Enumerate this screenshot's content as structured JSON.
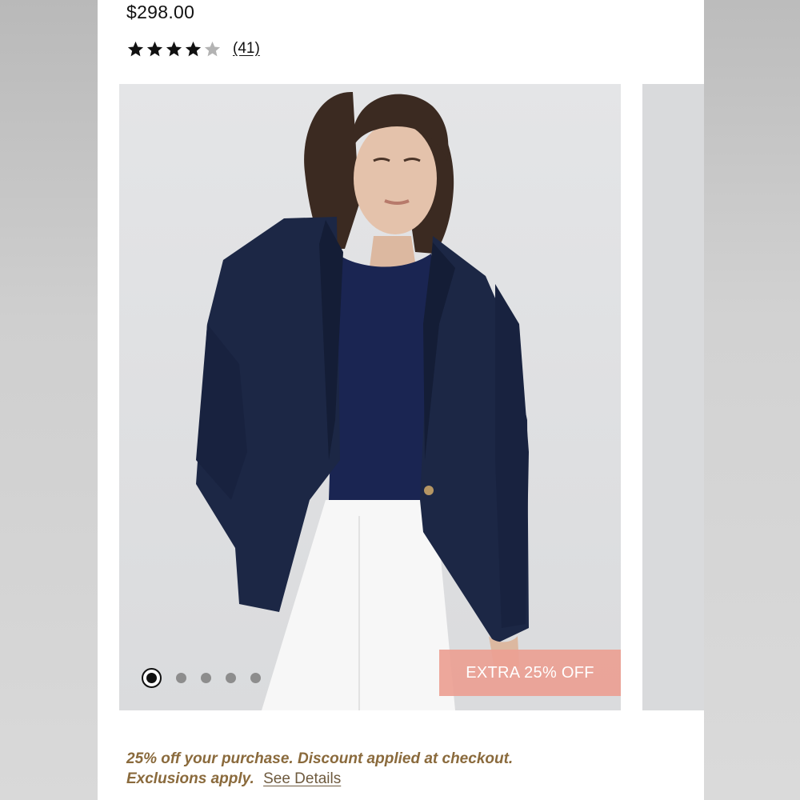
{
  "product": {
    "price": "$298.00",
    "rating": {
      "value": 4,
      "max": 5,
      "count_label": "(41)"
    }
  },
  "gallery": {
    "slide_count": 5,
    "active_slide": 1,
    "badge": "EXTRA 25% OFF"
  },
  "promo": {
    "text_line1": "25% off your purchase. Discount applied at checkout.",
    "text_line2": "Exclusions apply.",
    "link": "See Details"
  },
  "colors": {
    "star_filled": "#111111",
    "star_empty": "#b3b3b3",
    "badge_bg": "#eca092",
    "promo_text": "#8a6a3c",
    "blazer": "#1c2745",
    "top": "#1a2552"
  }
}
